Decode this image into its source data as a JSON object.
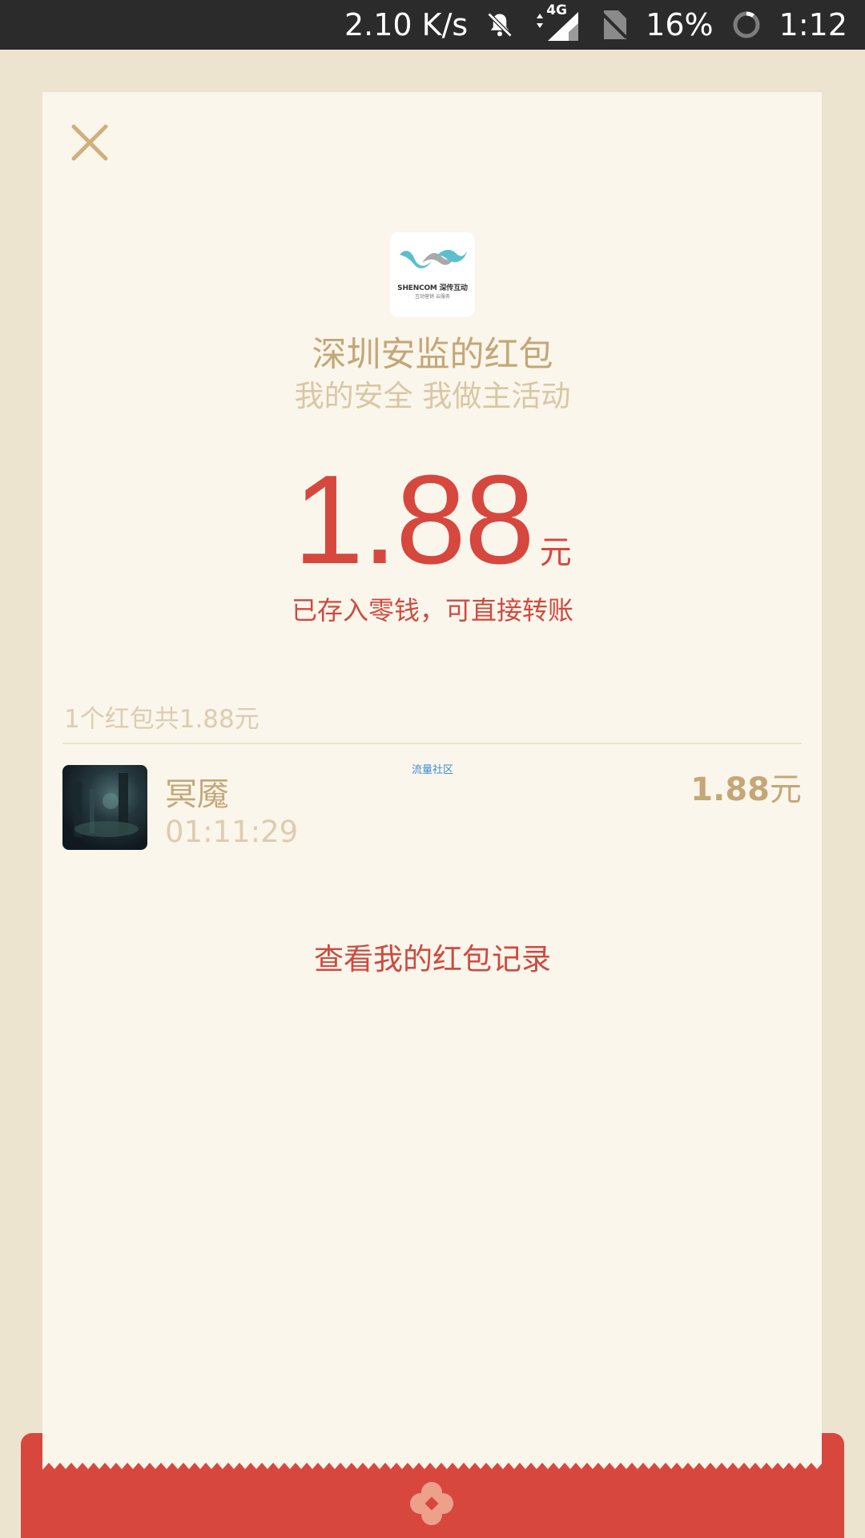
{
  "status_bar": {
    "net_speed": "2.10 K/s",
    "network_type": "4G",
    "battery": "16%",
    "time": "1:12",
    "icons": [
      "bell-off-icon",
      "data-arrows-icon",
      "signal-icon",
      "no-sim-icon",
      "battery-ring-icon"
    ]
  },
  "envelope": {
    "close_icon": "close-icon",
    "logo_brand": "SHENCOM 深传互动",
    "logo_tagline": "互动营销 云服务",
    "sender_name": "深圳安监的红包",
    "greeting": "我的安全 我做主活动",
    "amount": "1.88",
    "amount_unit": "元",
    "deposited_text": "已存入零钱，可直接转账",
    "summary": "1个红包共1.88元",
    "recipients": [
      {
        "name": "冥魇",
        "time": "01:11:29",
        "amount": "1.88",
        "unit": "元"
      }
    ],
    "watermark": "流量社区",
    "view_records_label": "查看我的红包记录"
  },
  "colors": {
    "accent_red": "#d6473e",
    "gold": "#c4a777",
    "light_gold": "#dccdb0",
    "card_bg": "#faf6ec",
    "page_bg": "#ede4d0"
  }
}
